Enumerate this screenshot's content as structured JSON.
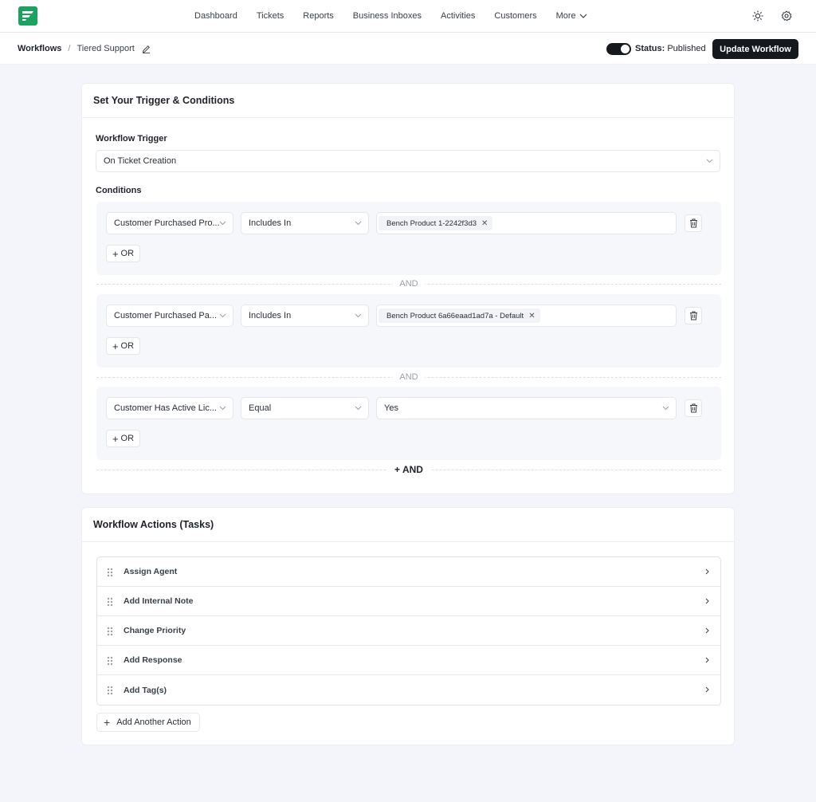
{
  "nav": {
    "items": [
      "Dashboard",
      "Tickets",
      "Reports",
      "Business Inboxes",
      "Activities",
      "Customers"
    ],
    "more_label": "More"
  },
  "breadcrumb": {
    "root": "Workflows",
    "separator": "/",
    "current": "Tiered Support"
  },
  "status": {
    "label": "Status:",
    "value": "Published"
  },
  "update_button": "Update Workflow",
  "trigger_card": {
    "title": "Set Your Trigger & Conditions",
    "trigger_label": "Workflow Trigger",
    "trigger_value": "On Ticket Creation",
    "conditions_label": "Conditions",
    "groups": [
      {
        "field": "Customer Purchased Pro...",
        "operator": "Includes In",
        "tag": "Bench Product 1-2242f3d3",
        "value_type": "tag"
      },
      {
        "field": "Customer Purchased Pa...",
        "operator": "Includes In",
        "tag": "Bench Product 6a66eaad1ad7a - Default",
        "value_type": "tag"
      },
      {
        "field": "Customer Has Active Lic...",
        "operator": "Equal",
        "value": "Yes",
        "value_type": "select"
      }
    ],
    "or_label": "OR",
    "and_label": "AND",
    "add_and_label": "+ AND"
  },
  "actions_card": {
    "title": "Workflow Actions (Tasks)",
    "actions": [
      "Assign Agent",
      "Add Internal Note",
      "Change Priority",
      "Add Response",
      "Add Tag(s)"
    ],
    "add_action_label": "Add Another Action"
  },
  "colors": {
    "brand": "#1aa260",
    "primary": "#15181d",
    "background": "#f4f5fa"
  }
}
